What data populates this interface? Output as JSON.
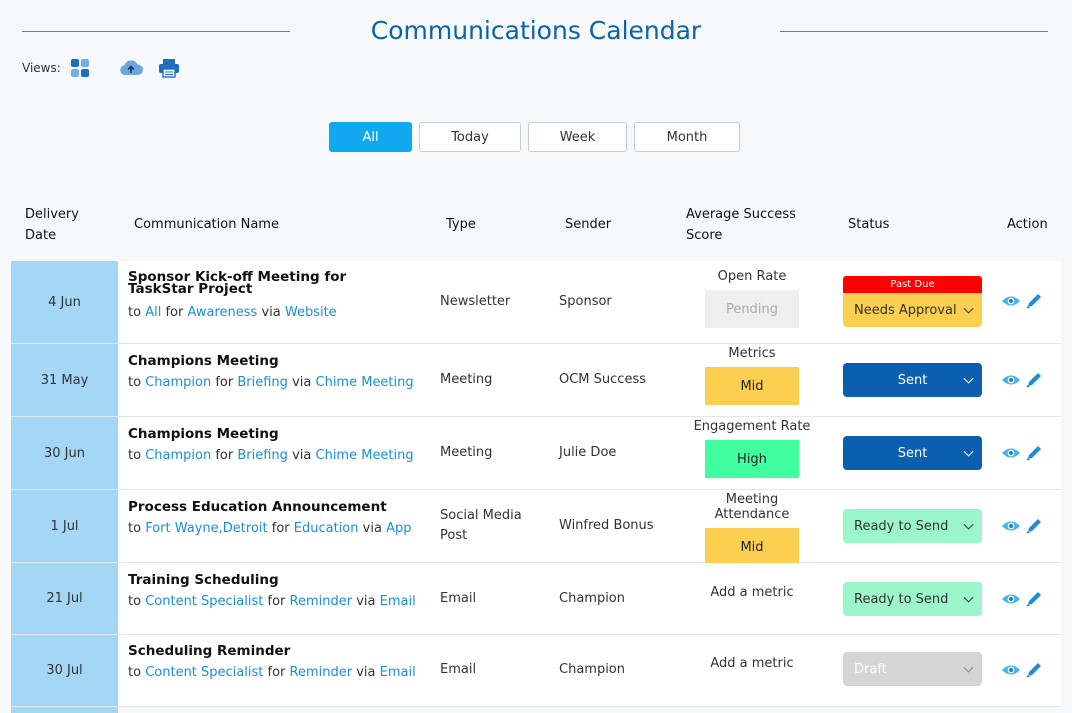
{
  "page": {
    "title": "Communications Calendar",
    "views_label": "Views:"
  },
  "icons": {
    "grid": "grid-view-icon",
    "cloud": "cloud-upload-icon",
    "print": "printer-icon",
    "eye": "eye-icon",
    "edit": "pencil-icon"
  },
  "filters": {
    "all": "All",
    "today": "Today",
    "week": "Week",
    "month": "Month",
    "active": "All"
  },
  "columns": {
    "delivery_line1": "Delivery",
    "delivery_line2": "Date",
    "name": "Communication Name",
    "type": "Type",
    "sender": "Sender",
    "score_line1": "Average Success",
    "score_line2": "Score",
    "status": "Status",
    "action": "Action"
  },
  "colors": {
    "accent": "#10a9ef",
    "title": "#0b63a8",
    "date_cell": "#a4d6f5",
    "past_due": "#ff0000",
    "status_needs_approval": "#fbcf4f",
    "status_sent": "#0b5fae",
    "status_ready": "#9bf7cb",
    "status_draft": "#d5d5d5",
    "score_mid": "#fbcf4f",
    "score_high": "#40ff9e",
    "score_pending": "#efefef"
  },
  "rows": [
    {
      "date": "4 Jun",
      "name": "Sponsor Kick-off Meeting for TaskStar Project",
      "to": "to",
      "audience": "All",
      "for": "for",
      "purpose": "Awareness",
      "via": "via",
      "channel": "Website",
      "type": "Newsletter",
      "sender": "Sponsor",
      "metric": "Open Rate",
      "score": "Pending",
      "past_due": "Past Due",
      "status": "Needs Approval"
    },
    {
      "date": "31 May",
      "name": "Champions Meeting",
      "to": "to",
      "audience": "Champion",
      "for": "for",
      "purpose": "Briefing",
      "via": "via",
      "channel": "Chime Meeting",
      "type": "Meeting",
      "sender": "OCM Success",
      "metric": "Metrics",
      "score": "Mid",
      "status": "Sent"
    },
    {
      "date": "30 Jun",
      "name": "Champions Meeting",
      "to": "to",
      "audience": "Champion",
      "for": "for",
      "purpose": "Briefing",
      "via": "via",
      "channel": "Chime Meeting",
      "type": "Meeting",
      "sender": "Julie Doe",
      "metric": "Engagement Rate",
      "score": "High",
      "status": "Sent"
    },
    {
      "date": "1 Jul",
      "name": "Process Education Announcement",
      "to": "to",
      "audience": "Fort Wayne,Detroit",
      "for": "for",
      "purpose": "Education",
      "via": "via",
      "channel": "App",
      "type_line1": "Social Media",
      "type_line2": "Post",
      "sender": "Winfred Bonus",
      "metric": "Meeting Attendance",
      "score": "Mid",
      "status": "Ready to Send"
    },
    {
      "date": "21 Jul",
      "name": "Training Scheduling",
      "to": "to",
      "audience": "Content Specialist",
      "for": "for",
      "purpose": "Reminder",
      "via": "via",
      "channel": "Email",
      "type": "Email",
      "sender": "Champion",
      "add_metric": "Add a metric",
      "status": "Ready to Send"
    },
    {
      "date": "30 Jul",
      "name": "Scheduling Reminder",
      "to": "to",
      "audience": "Content Specialist",
      "for": "for",
      "purpose": "Reminder",
      "via": "via",
      "channel": "Email",
      "type": "Email",
      "sender": "Champion",
      "add_metric": "Add a metric",
      "status": "Draft"
    }
  ]
}
